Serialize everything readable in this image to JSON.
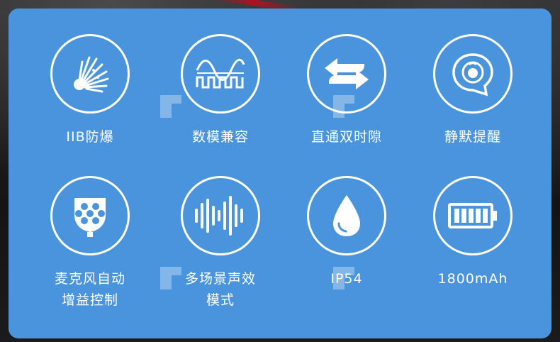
{
  "features": [
    {
      "icon": "explosion-proof-icon",
      "label_lines": [
        "IIB防爆"
      ]
    },
    {
      "icon": "digital-analog-wave-icon",
      "label_lines": [
        "数模兼容"
      ]
    },
    {
      "icon": "direct-dual-slot-arrows-icon",
      "label_lines": [
        "直通双时隙"
      ]
    },
    {
      "icon": "silent-alert-speech-bubble-icon",
      "label_lines": [
        "静默提醒"
      ]
    },
    {
      "icon": "microphone-grille-icon",
      "label_lines": [
        "麦克风自动",
        "增益控制"
      ]
    },
    {
      "icon": "sound-wave-bars-icon",
      "label_lines": [
        "多场景声效",
        "模式"
      ]
    },
    {
      "icon": "water-drop-icon",
      "label_lines": [
        "IP54"
      ]
    },
    {
      "icon": "battery-full-icon",
      "label_lines": [
        "1800mAh"
      ]
    }
  ],
  "colors": {
    "panel": "#4a94dd",
    "icon": "#ffffff"
  }
}
